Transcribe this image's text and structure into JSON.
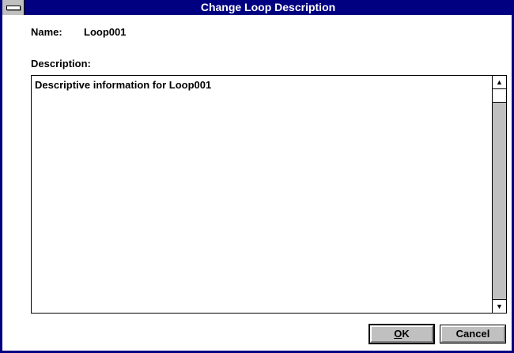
{
  "window": {
    "title": "Change Loop Description"
  },
  "form": {
    "name_label": "Name:",
    "name_value": "Loop001",
    "description_label": "Description:",
    "description_value": "Descriptive information for Loop001"
  },
  "buttons": {
    "ok_mnemonic": "O",
    "ok_rest": "K",
    "cancel_label": "Cancel"
  },
  "icons": {
    "system_menu": "system-menu-icon",
    "scroll_up": "arrow-up-icon",
    "scroll_down": "arrow-down-icon"
  },
  "colors": {
    "titlebar": "#000080",
    "button_face": "#c0c0c0"
  }
}
